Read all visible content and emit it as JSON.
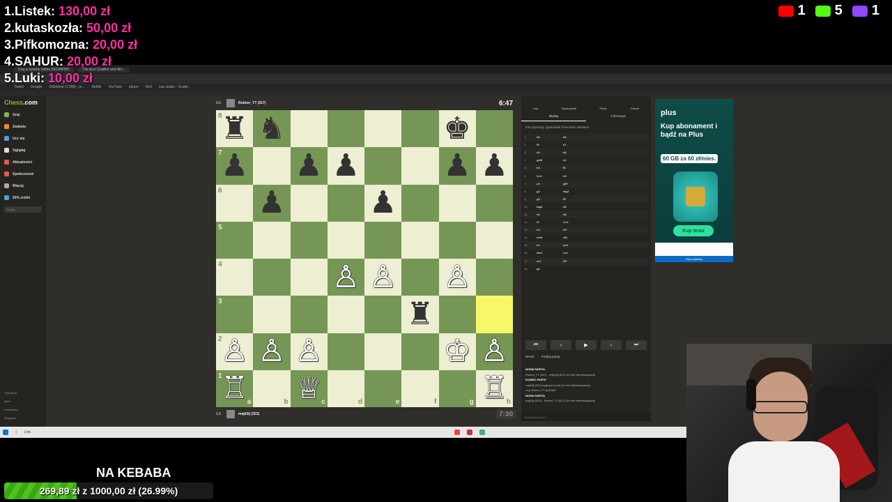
{
  "overlay": {
    "donations": [
      {
        "rank": "1.",
        "name": "Listek:",
        "amount": "130,00 zł"
      },
      {
        "rank": "2.",
        "name": "kutaskozła:",
        "amount": "50,00 zł"
      },
      {
        "rank": "3.",
        "name": "Pifkomozna:",
        "amount": "20,00 zł"
      },
      {
        "rank": "4.",
        "name": "SAHUR:",
        "amount": "20,00 zł"
      },
      {
        "rank": "5.",
        "name": "Luki:",
        "amount": "10,00 zł"
      }
    ],
    "socials": [
      {
        "icon": "youtube-icon",
        "count": "1",
        "color": "#ff0000"
      },
      {
        "icon": "kick-icon",
        "count": "5",
        "color": "#53fc18"
      },
      {
        "icon": "twitch-icon",
        "count": "1",
        "color": "#9146ff"
      }
    ],
    "goal": {
      "title": "NA KEBABA",
      "progress_text": "269,89 zł z 1000,00 zł (26.99%)",
      "progress": 0.2699
    }
  },
  "browser": {
    "tabs": [
      "Graj w szachy online ZA DARMO",
      "The best ChatBot and Wri..."
    ],
    "bookmarks": [
      "Twitch",
      "Google",
      "Odsłonne (1 008) - je...",
      "Netflix",
      "YouTube",
      "steam",
      "Kick",
      "trac studio - Soubji..."
    ]
  },
  "sidebar": {
    "logo_a": "Chess",
    "logo_b": ".com",
    "items": [
      {
        "label": "Graj",
        "color": "#81b64c"
      },
      {
        "label": "Zadania",
        "color": "#e58f2a"
      },
      {
        "label": "Ucz się",
        "color": "#5d9bd5"
      },
      {
        "label": "Oglądaj",
        "color": "#dddddd"
      },
      {
        "label": "Aktualności",
        "color": "#e05a4f"
      },
      {
        "label": "Społeczność",
        "color": "#e05a4f"
      },
      {
        "label": "Więcej",
        "color": "#aaaaaa"
      },
      {
        "label": "50% zniżki",
        "color": "#3fa9e0"
      }
    ],
    "search_placeholder": "Szukaj",
    "bottom": [
      "Tryb jasny",
      "Zwiń",
      "Ustawienia",
      "Wsparcie"
    ]
  },
  "game": {
    "top_player": {
      "score": "0.0",
      "name": "Robion_YT (617)",
      "clock": "6:47"
    },
    "bottom_player": {
      "score": "1.0",
      "name": "majk3lj (323)",
      "clock": "7:30"
    },
    "ranks": [
      "8",
      "7",
      "6",
      "5",
      "4",
      "3",
      "2",
      "1"
    ],
    "files": [
      "a",
      "b",
      "c",
      "d",
      "e",
      "f",
      "g",
      "h"
    ],
    "highlight": [
      "h3"
    ],
    "position": {
      "a8": "♜",
      "b8": "♞",
      "g8": "♚",
      "a7": "♟",
      "c7": "♟",
      "d7": "♟",
      "g7": "♟",
      "h7": "♟",
      "b6": "♟",
      "e6": "♟",
      "d4": "♙",
      "e4": "♙",
      "g4": "♙",
      "f3": "♜",
      "a2": "♙",
      "b2": "♙",
      "c2": "♙",
      "g2": "♔",
      "h2": "♙",
      "a1": "♖",
      "c1": "♕",
      "h1": "♖"
    },
    "piece_colors": {
      "a8": "b",
      "b8": "b",
      "g8": "b",
      "a7": "b",
      "c7": "b",
      "d7": "b",
      "g7": "b",
      "h7": "b",
      "b6": "b",
      "e6": "b",
      "f3": "b",
      "d4": "w",
      "e4": "w",
      "g4": "w",
      "a2": "w",
      "b2": "w",
      "c2": "w",
      "g2": "w",
      "h2": "w",
      "a1": "w",
      "c1": "w",
      "h1": "w"
    }
  },
  "panel": {
    "tabs": [
      "Graj",
      "Nowa partia",
      "Partie",
      "Gracze"
    ],
    "subtabs": [
      "Ruchy",
      "Informacje"
    ],
    "opening": "FIM Opening: Queenside Fianchetto Variation",
    "moves": [
      {
        "n": "1.",
        "w": "d4",
        "b": "b6"
      },
      {
        "n": "2.",
        "w": "f3",
        "b": "b7"
      },
      {
        "n": "3.",
        "w": "e3",
        "b": "d3"
      },
      {
        "n": "4.",
        "w": "gxf3",
        "b": "e6"
      },
      {
        "n": "5.",
        "w": "h3",
        "b": "f6"
      },
      {
        "n": "6.",
        "w": "O-O",
        "b": "h5"
      },
      {
        "n": "7.",
        "w": "c3",
        "b": "g5+"
      },
      {
        "n": "8.",
        "w": "g2",
        "b": "fxg4"
      },
      {
        "n": "9.",
        "w": "g4",
        "b": "f5"
      },
      {
        "n": "10.",
        "w": "fxg4",
        "b": "d6"
      },
      {
        "n": "11.",
        "w": "e4",
        "b": "d5"
      },
      {
        "n": "12.",
        "w": "f3",
        "b": "O-O"
      },
      {
        "n": "13.",
        "w": "h3",
        "b": "f4+"
      },
      {
        "n": "14.",
        "w": "exf4",
        "b": "xf4"
      },
      {
        "n": "15.",
        "w": "h1",
        "b": "xe4"
      },
      {
        "n": "16.",
        "w": "fxe4",
        "b": "xc1"
      },
      {
        "n": "17.",
        "w": "xc1",
        "b": "f3+"
      },
      {
        "n": "18.",
        "w": "g2",
        "b": ""
      }
    ],
    "nav": [
      "⏮",
      "‹",
      "▶",
      "›",
      "⏭"
    ],
    "actions": [
      "Remis",
      "Poddaj partię"
    ],
    "chat": [
      {
        "h": "NOWA PARTIA",
        "t": "Robion_YT (617) - majk3lj (323) (10 min Nierankingowa)"
      },
      {
        "h": "KONIEC PARTII",
        "t": "majk3lj (323) wygrywa (mat) (10 min Nierankingowa)"
      },
      {
        "h": "",
        "t": "Czy Robion_YT grał fair?"
      },
      {
        "h": "NOWA PARTIA",
        "t": "majk3lj (323) - Robion_YT (617) (10 min Nierankingowa)"
      }
    ],
    "chat_placeholder": "Wyślij wiadomość..."
  },
  "ad": {
    "logo": "plus",
    "headline": "Kup abonament i bądź na Plus",
    "badge": "60 GB za 60 zł/mies.",
    "button": "Kup teraz",
    "footer": "Użyć reklamy"
  },
  "taskbar": {
    "search_label": "Link"
  }
}
